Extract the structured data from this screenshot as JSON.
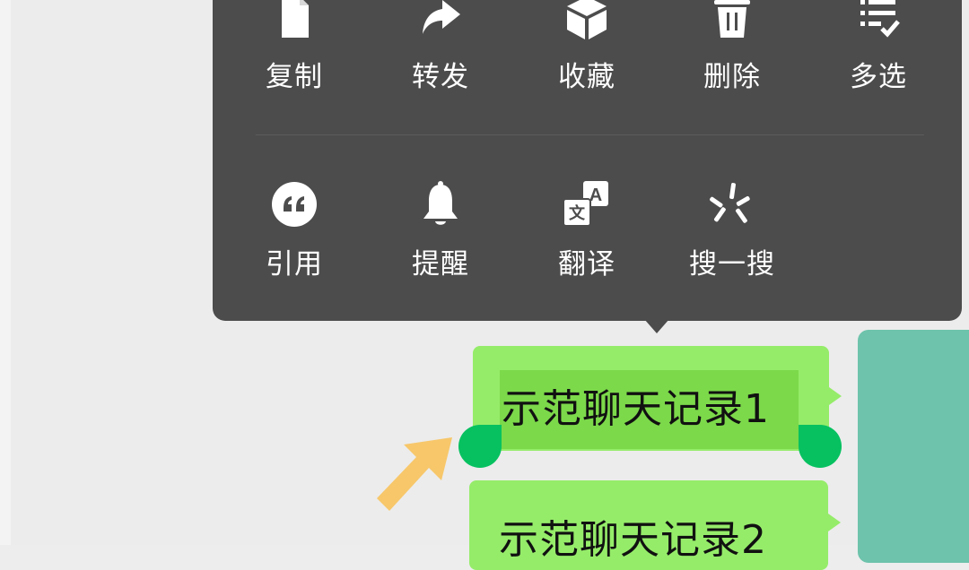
{
  "context_menu": {
    "row1": [
      {
        "label": "复制",
        "icon": "copy-icon"
      },
      {
        "label": "转发",
        "icon": "forward-icon"
      },
      {
        "label": "收藏",
        "icon": "favorite-icon"
      },
      {
        "label": "删除",
        "icon": "delete-icon"
      },
      {
        "label": "多选",
        "icon": "multi-select-icon"
      }
    ],
    "row2": [
      {
        "label": "引用",
        "icon": "quote-icon"
      },
      {
        "label": "提醒",
        "icon": "remind-bell-icon"
      },
      {
        "label": "翻译",
        "icon": "translate-icon"
      },
      {
        "label": "搜一搜",
        "icon": "search-spark-icon"
      }
    ]
  },
  "messages": [
    {
      "text": "示范聊天记录1",
      "selected": true
    },
    {
      "text": "示范聊天记录2",
      "selected": false
    }
  ],
  "translate_glyphs": {
    "a": "A",
    "wen": "文"
  },
  "colors": {
    "menu_bg": "#4c4c4c",
    "bubble": "#95ec69",
    "selection_handle": "#07c160",
    "avatar": "#6dc3ab",
    "pointer_arrow": "#f7c76a"
  }
}
